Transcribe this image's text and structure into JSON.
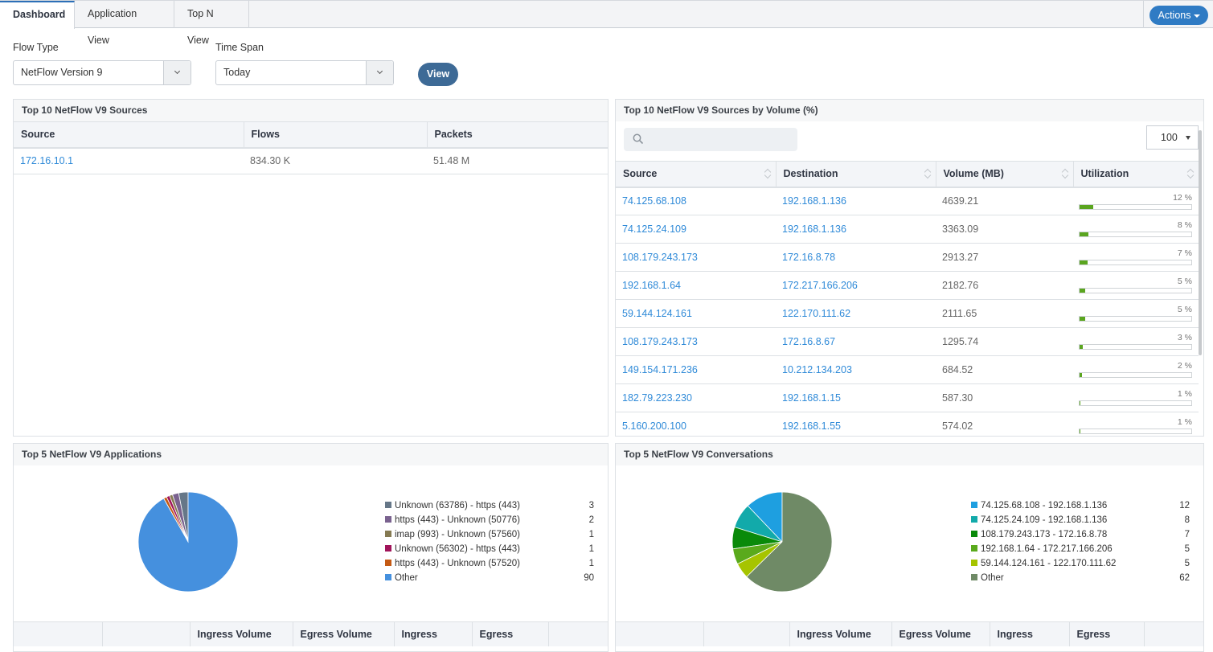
{
  "tabs": [
    {
      "label": "Dashboard",
      "active": true
    },
    {
      "label": "Application View",
      "active": false
    },
    {
      "label": "Top N View",
      "active": false
    }
  ],
  "actions_label": "Actions",
  "filters": {
    "flow_type_label": "Flow Type",
    "flow_type_value": "NetFlow Version 9",
    "time_span_label": "Time Span",
    "time_span_value": "Today",
    "view_label": "View"
  },
  "top_sources": {
    "title": "Top 10 NetFlow V9 Sources",
    "columns": [
      "Source",
      "Flows",
      "Packets"
    ],
    "rows": [
      {
        "source": "172.16.10.1",
        "flows": "834.30 K",
        "packets": "51.48 M"
      }
    ]
  },
  "sources_by_volume": {
    "title": "Top 10 NetFlow V9 Sources by Volume (%)",
    "search_placeholder": "",
    "page_size": "100",
    "columns": [
      "Source",
      "Destination",
      "Volume (MB)",
      "Utilization"
    ],
    "rows": [
      {
        "source": "74.125.68.108",
        "destination": "192.168.1.136",
        "volume": "4639.21",
        "util_label": "12 %",
        "util": 12
      },
      {
        "source": "74.125.24.109",
        "destination": "192.168.1.136",
        "volume": "3363.09",
        "util_label": "8 %",
        "util": 8
      },
      {
        "source": "108.179.243.173",
        "destination": "172.16.8.78",
        "volume": "2913.27",
        "util_label": "7 %",
        "util": 7
      },
      {
        "source": "192.168.1.64",
        "destination": "172.217.166.206",
        "volume": "2182.76",
        "util_label": "5 %",
        "util": 5
      },
      {
        "source": "59.144.124.161",
        "destination": "122.170.111.62",
        "volume": "2111.65",
        "util_label": "5 %",
        "util": 5
      },
      {
        "source": "108.179.243.173",
        "destination": "172.16.8.67",
        "volume": "1295.74",
        "util_label": "3 %",
        "util": 3
      },
      {
        "source": "149.154.171.236",
        "destination": "10.212.134.203",
        "volume": "684.52",
        "util_label": "2 %",
        "util": 2
      },
      {
        "source": "182.79.223.230",
        "destination": "192.168.1.15",
        "volume": "587.30",
        "util_label": "1 %",
        "util": 1
      },
      {
        "source": "5.160.200.100",
        "destination": "192.168.1.55",
        "volume": "574.02",
        "util_label": "1 %",
        "util": 1
      }
    ]
  },
  "applications": {
    "title": "Top 5 NetFlow V9 Applications",
    "table_columns": [
      "",
      "",
      "Ingress Volume",
      "Egress Volume",
      "Ingress",
      "Egress",
      ""
    ]
  },
  "conversations": {
    "title": "Top 5 NetFlow V9 Conversations",
    "table_columns": [
      "",
      "",
      "Ingress Volume",
      "Egress Volume",
      "Ingress",
      "Egress",
      ""
    ]
  },
  "chart_data": [
    {
      "type": "pie",
      "title": "Top 5 NetFlow V9 Applications",
      "legend": "right",
      "categories": [
        "Unknown (63786) - https (443)",
        "https (443) - Unknown (50776)",
        "imap (993) - Unknown (57560)",
        "Unknown (56302) - https (443)",
        "https (443) - Unknown (57520)",
        "Other"
      ],
      "values": [
        3,
        2,
        1,
        1,
        1,
        90
      ],
      "colors": [
        "#667788",
        "#7a628f",
        "#857a52",
        "#a0145a",
        "#c45a14",
        "#4590de"
      ]
    },
    {
      "type": "pie",
      "title": "Top 5 NetFlow V9 Conversations",
      "legend": "right",
      "categories": [
        "74.125.68.108 - 192.168.1.136",
        "74.125.24.109 - 192.168.1.136",
        "108.179.243.173 - 172.16.8.78",
        "192.168.1.64 - 172.217.166.206",
        "59.144.124.161 - 122.170.111.62",
        "Other"
      ],
      "values": [
        12,
        8,
        7,
        5,
        5,
        62
      ],
      "colors": [
        "#1e9fe0",
        "#12aaaa",
        "#0a8a0a",
        "#5aaa1c",
        "#a6c400",
        "#6f8a66"
      ]
    }
  ]
}
